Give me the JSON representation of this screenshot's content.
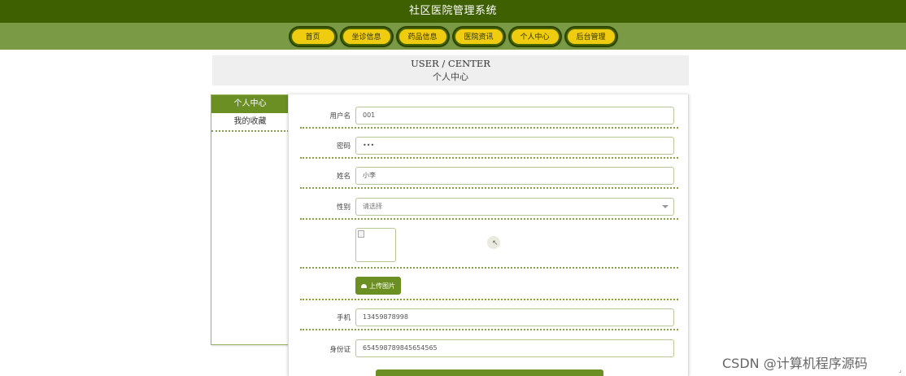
{
  "app": {
    "title": "社区医院管理系统"
  },
  "nav": {
    "items": [
      {
        "label": "首页"
      },
      {
        "label": "坐诊信息"
      },
      {
        "label": "药品信息"
      },
      {
        "label": "医院资讯"
      },
      {
        "label": "个人中心"
      },
      {
        "label": "后台管理"
      }
    ]
  },
  "header": {
    "en": "USER / CENTER",
    "cn": "个人中心"
  },
  "sidebar": {
    "items": [
      {
        "label": "个人中心",
        "active": true
      },
      {
        "label": "我的收藏",
        "active": false
      }
    ]
  },
  "form": {
    "username": {
      "label": "用户名",
      "value": "001"
    },
    "password": {
      "label": "密码",
      "value": "•••"
    },
    "name": {
      "label": "姓名",
      "value": "小李"
    },
    "gender": {
      "label": "性别",
      "value": "请选择"
    },
    "upload_label": "上传图片",
    "phone": {
      "label": "手机",
      "value": "13459878998"
    },
    "id_card": {
      "label": "身份证",
      "value": "654598789845654565"
    }
  },
  "watermark": "CSDN @计算机程序源码",
  "colors": {
    "title_bar": "#3f6000",
    "nav_bar": "#7a9a46",
    "nav_button": "#f0cc10",
    "accent_green": "#6b8f22",
    "dotted_divider": "#8aa14a"
  },
  "icons": {
    "upload": "cloud-upload-icon",
    "select": "chevron-down-icon",
    "image": "broken-image-icon"
  }
}
